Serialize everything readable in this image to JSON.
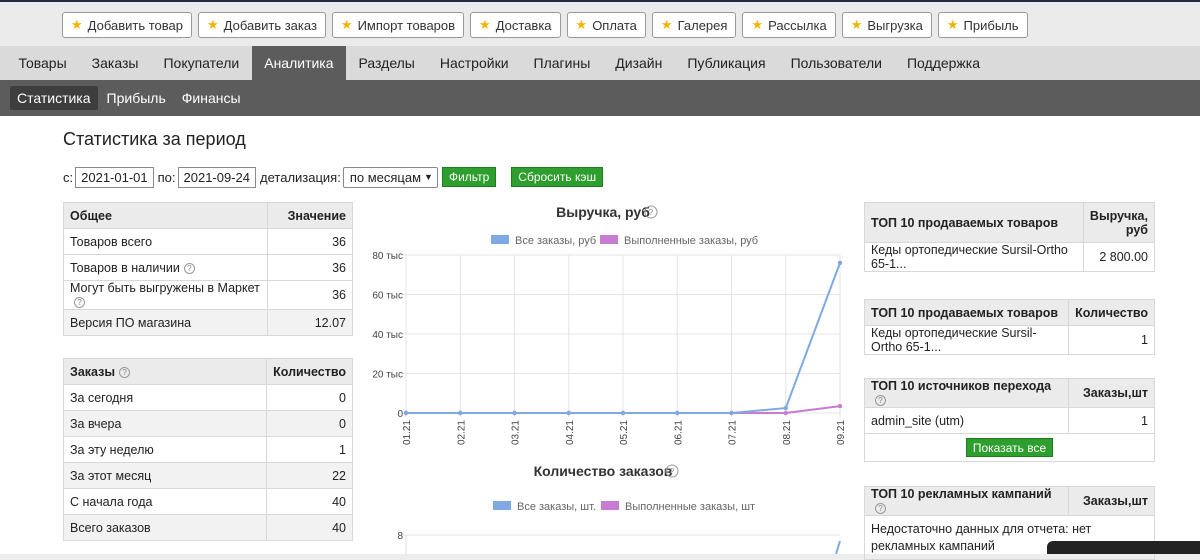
{
  "quick_buttons": [
    "Добавить товар",
    "Добавить заказ",
    "Импорт товаров",
    "Доставка",
    "Оплата",
    "Галерея",
    "Рассылка",
    "Выгрузка",
    "Прибыль"
  ],
  "main_nav": [
    "Товары",
    "Заказы",
    "Покупатели",
    "Аналитика",
    "Разделы",
    "Настройки",
    "Плагины",
    "Дизайн",
    "Публикация",
    "Пользователи",
    "Поддержка"
  ],
  "sub_nav": [
    "Статистика",
    "Прибыль",
    "Финансы"
  ],
  "page_title": "Статистика за период",
  "filter": {
    "from_label": "с:",
    "from_value": "2021-01-01",
    "to_label": "по:",
    "to_value": "2021-09-24",
    "detail_label": "детализация:",
    "detail_value": "по месяцам",
    "filter_button": "Фильтр",
    "reset_button": "Сбросить кэш"
  },
  "general": {
    "headers": [
      "Общее",
      "Значение"
    ],
    "rows": [
      [
        "Товаров всего",
        "36"
      ],
      [
        "Товаров в наличии",
        "36"
      ],
      [
        "Могут быть выгружены в Маркет",
        "36"
      ],
      [
        "Версия ПО магазина",
        "12.07"
      ]
    ]
  },
  "orders": {
    "headers": [
      "Заказы",
      "Количество"
    ],
    "rows": [
      [
        "За сегодня",
        "0"
      ],
      [
        "За вчера",
        "0"
      ],
      [
        "За эту неделю",
        "1"
      ],
      [
        "За этот месяц",
        "22"
      ],
      [
        "С начала года",
        "40"
      ],
      [
        "Всего заказов",
        "40"
      ]
    ]
  },
  "top_revenue": {
    "headers": [
      "ТОП 10 продаваемых товаров",
      "Выручка, руб"
    ],
    "rows": [
      [
        "Кеды ортопедические Sursil-Ortho 65-1...",
        "2 800.00"
      ]
    ]
  },
  "top_qty": {
    "headers": [
      "ТОП 10 продаваемых товаров",
      "Количество"
    ],
    "rows": [
      [
        "Кеды ортопедические Sursil-Ortho 65-1...",
        "1"
      ]
    ]
  },
  "top_sources": {
    "headers": [
      "ТОП 10 источников перехода",
      "Заказы,шт"
    ],
    "rows": [
      [
        "admin_site (utm)",
        "1"
      ]
    ],
    "show_all": "Показать все"
  },
  "top_campaigns": {
    "headers": [
      "ТОП 10 рекламных кампаний",
      "Заказы,шт"
    ],
    "note": "Недостаточно данных для отчета: нет рекламных кампаний"
  },
  "colors": {
    "series_all": "#7ea9e3",
    "series_done": "#c77bd1",
    "green": "#2e9e2e",
    "nav_active": "#5c5c5c"
  },
  "chart_data": [
    {
      "type": "line",
      "title": "Выручка, руб",
      "categories": [
        "01.21",
        "02.21",
        "03.21",
        "04.21",
        "05.21",
        "06.21",
        "07.21",
        "08.21",
        "09.21"
      ],
      "ylim": [
        0,
        80000
      ],
      "ytick_labels": [
        "0",
        "20 тыс",
        "40 тыс",
        "60 тыс",
        "80 тыс"
      ],
      "series": [
        {
          "name": "Все заказы, руб",
          "values": [
            0,
            0,
            0,
            0,
            0,
            0,
            0,
            2500,
            76000
          ]
        },
        {
          "name": "Выполненные заказы, руб",
          "values": [
            0,
            0,
            0,
            0,
            0,
            0,
            0,
            0,
            3500
          ]
        }
      ]
    },
    {
      "type": "line",
      "title": "Количество заказов",
      "ytick_labels": [
        "8"
      ],
      "series": [
        {
          "name": "Все заказы, шт.",
          "values": []
        },
        {
          "name": "Выполненные заказы, шт",
          "values": []
        }
      ]
    }
  ]
}
